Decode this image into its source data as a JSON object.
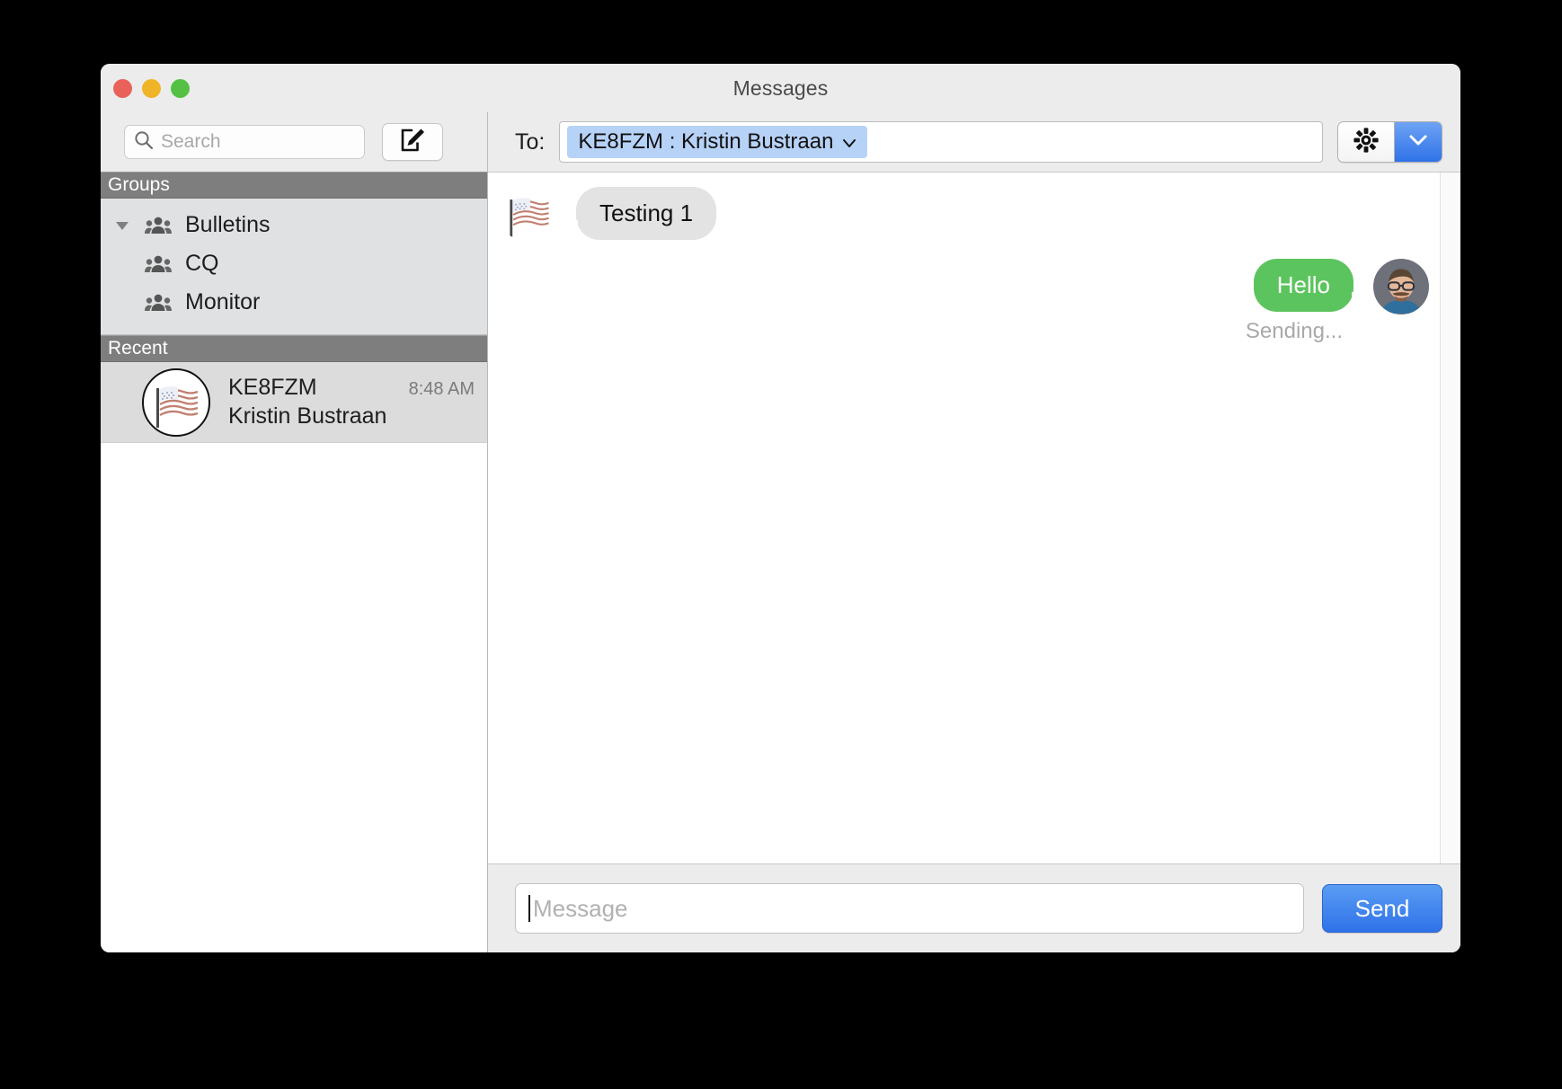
{
  "window": {
    "title": "Messages",
    "traffic_lights": [
      {
        "name": "close",
        "color": "#e8625a"
      },
      {
        "name": "minimize",
        "color": "#f0b429"
      },
      {
        "name": "maximize",
        "color": "#55c144"
      }
    ]
  },
  "sidebar": {
    "search": {
      "value": "",
      "placeholder": "Search",
      "icon": "search-icon"
    },
    "compose_button": {
      "icon": "compose-pencil-icon",
      "label": ""
    },
    "groups": {
      "header": "Groups",
      "items": [
        {
          "label": "Bulletins",
          "icon": "people-group-icon",
          "disclosure": "▼",
          "expanded": true
        },
        {
          "label": "CQ",
          "icon": "people-group-icon",
          "disclosure": "",
          "expanded": false
        },
        {
          "label": "Monitor",
          "icon": "people-group-icon",
          "disclosure": "",
          "expanded": false
        }
      ]
    },
    "recent": {
      "header": "Recent",
      "items": [
        {
          "callsign": "KE8FZM",
          "name": "Kristin Bustraan",
          "time": "8:48 AM",
          "avatar_icon": "us-flag-avatar",
          "avatar_glyph": "🇺🇸",
          "selected": true
        }
      ]
    }
  },
  "conversation": {
    "to_label": "To:",
    "to_token": "KE8FZM : Kristin Bustraan",
    "to_token_chevron": "⌄",
    "to_field_value": "",
    "settings": {
      "gear_icon": "gear-icon",
      "dropdown_icon": "chevron-down-icon"
    },
    "messages": [
      {
        "direction": "incoming",
        "text": "Testing 1",
        "avatar_icon": "us-flag-avatar",
        "avatar_glyph": "🇺🇸",
        "status": "",
        "bubble_color": "#e3e3e3"
      },
      {
        "direction": "outgoing",
        "text": "Hello",
        "avatar_icon": "user-photo-avatar",
        "avatar_glyph": "",
        "status": "Sending...",
        "bubble_color": "#5cc45e"
      }
    ],
    "compose": {
      "input_value": "",
      "input_placeholder": "Message",
      "send_label": "Send"
    }
  },
  "colors": {
    "accent_blue": "#2f72e8",
    "sent_bubble_green": "#5cc45e",
    "token_blue": "#b7d2f7",
    "section_header_gray": "#7e7e7e"
  }
}
